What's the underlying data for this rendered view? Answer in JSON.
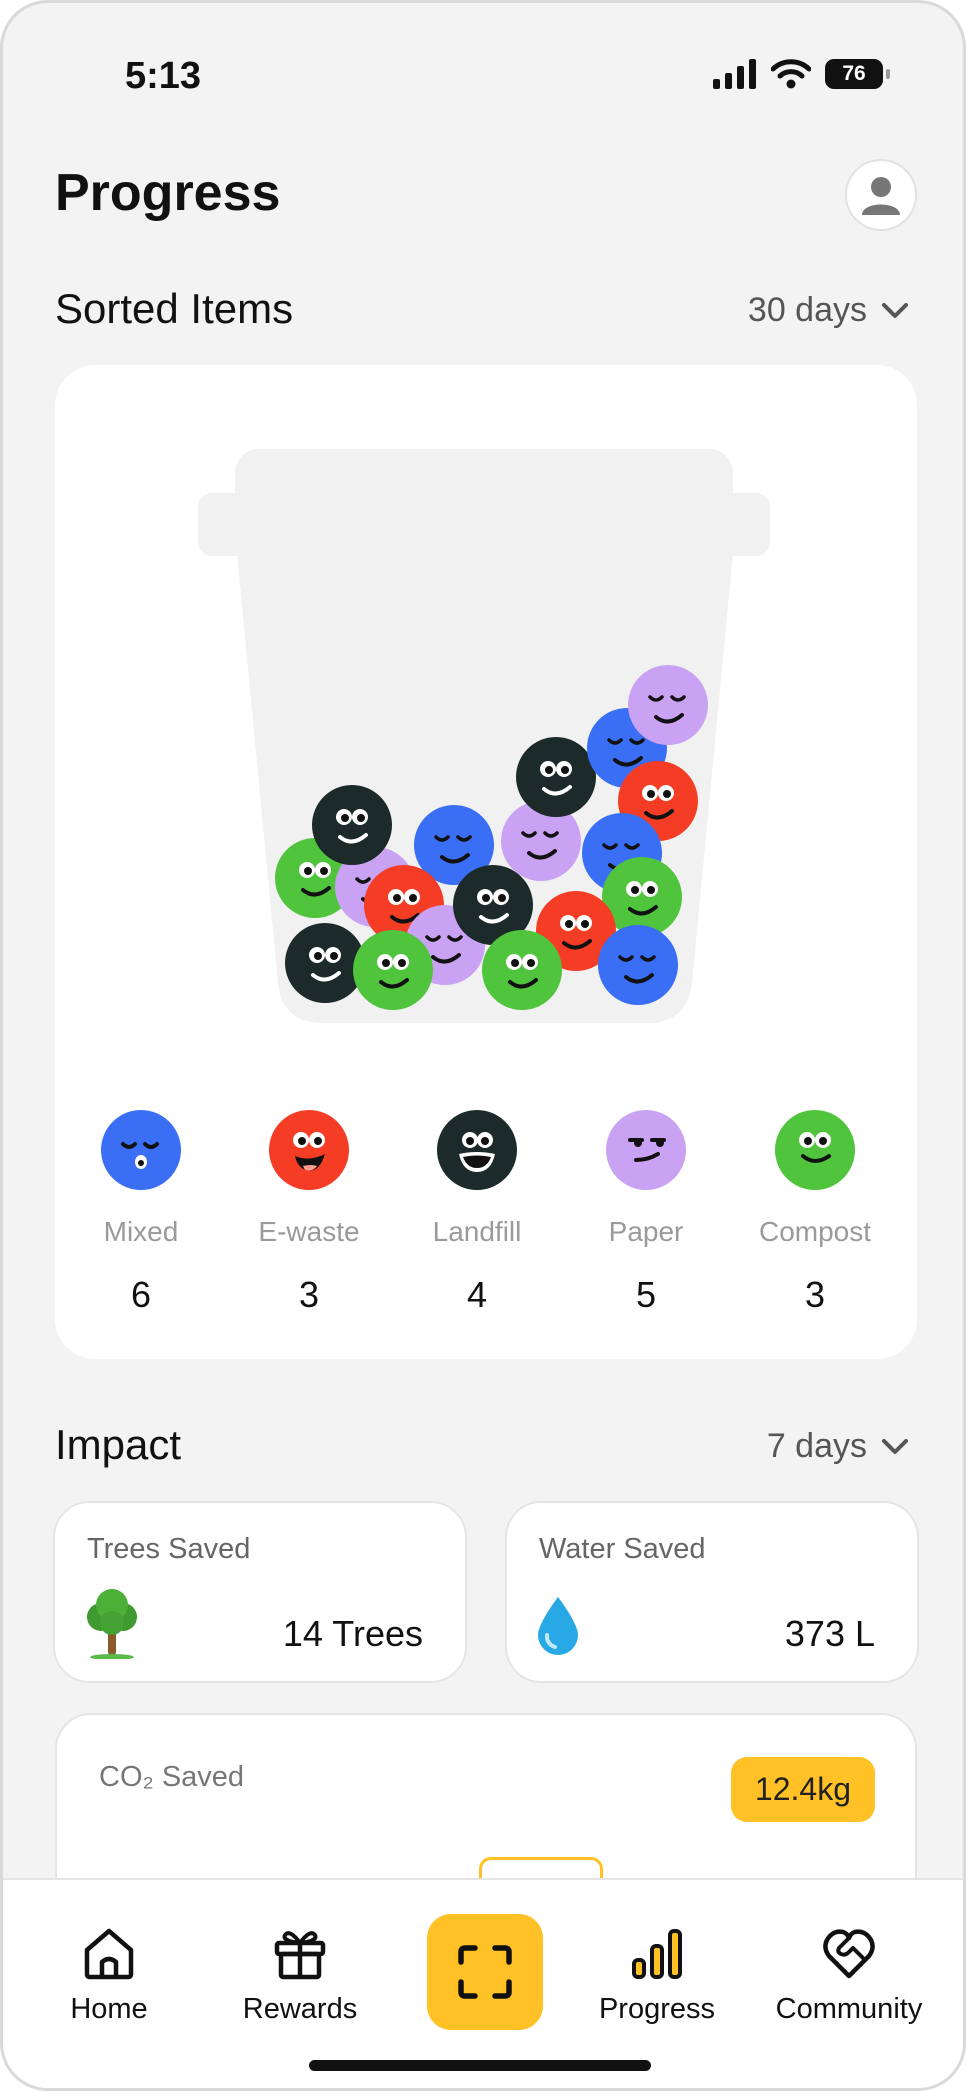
{
  "status": {
    "time": "5:13",
    "battery": "76"
  },
  "header": {
    "title": "Progress"
  },
  "sorted": {
    "title": "Sorted Items",
    "period": "30 days",
    "categories": [
      {
        "label": "Mixed",
        "count": "6",
        "color": "#3a6ff5"
      },
      {
        "label": "E-waste",
        "count": "3",
        "color": "#f53d26"
      },
      {
        "label": "Landfill",
        "count": "4",
        "color": "#1c2a2a"
      },
      {
        "label": "Paper",
        "count": "5",
        "color": "#c9a2f3"
      },
      {
        "label": "Compost",
        "count": "3",
        "color": "#4fc43c"
      }
    ]
  },
  "impact": {
    "title": "Impact",
    "period": "7 days",
    "trees": {
      "label": "Trees Saved",
      "value": "14 Trees",
      "icon": "tree-icon"
    },
    "water": {
      "label": "Water Saved",
      "value": "373 L",
      "icon": "water-drop-icon"
    },
    "co2": {
      "label": "CO₂ Saved",
      "value": "12.4kg"
    }
  },
  "tabbar": {
    "home": "Home",
    "rewards": "Rewards",
    "progress": "Progress",
    "community": "Community"
  },
  "colors": {
    "accent": "#ffc125",
    "background": "#f3f3f3"
  }
}
